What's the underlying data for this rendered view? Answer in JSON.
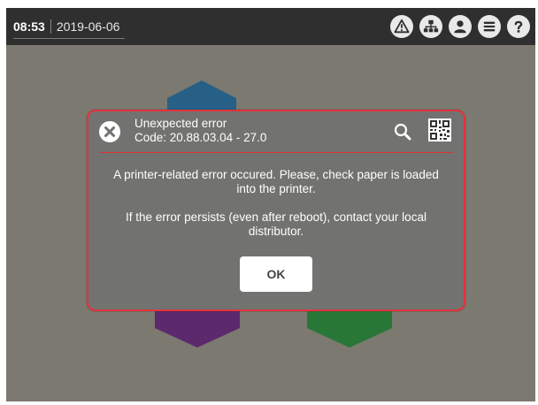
{
  "topbar": {
    "time": "08:53",
    "date": "2019-06-06",
    "icons": [
      "warning-icon",
      "network-icon",
      "user-icon",
      "menu-icon",
      "help-icon"
    ]
  },
  "colors": {
    "background": "#7e7c72",
    "topbar": "#2f2f2f",
    "dialog_bg": "#727270",
    "dialog_border": "#e2333b",
    "hex_blue": "#1b5e8c",
    "hex_purple": "#5a1e6e",
    "hex_green": "#1e7a2e"
  },
  "dialog": {
    "title": "Unexpected error",
    "code": "Code: 20.88.03.04 - 27.0",
    "message1": "A printer-related error occured. Please, check paper is loaded into the printer.",
    "message2": "If the error persists (even after reboot), contact your local distributor.",
    "ok_label": "OK"
  }
}
